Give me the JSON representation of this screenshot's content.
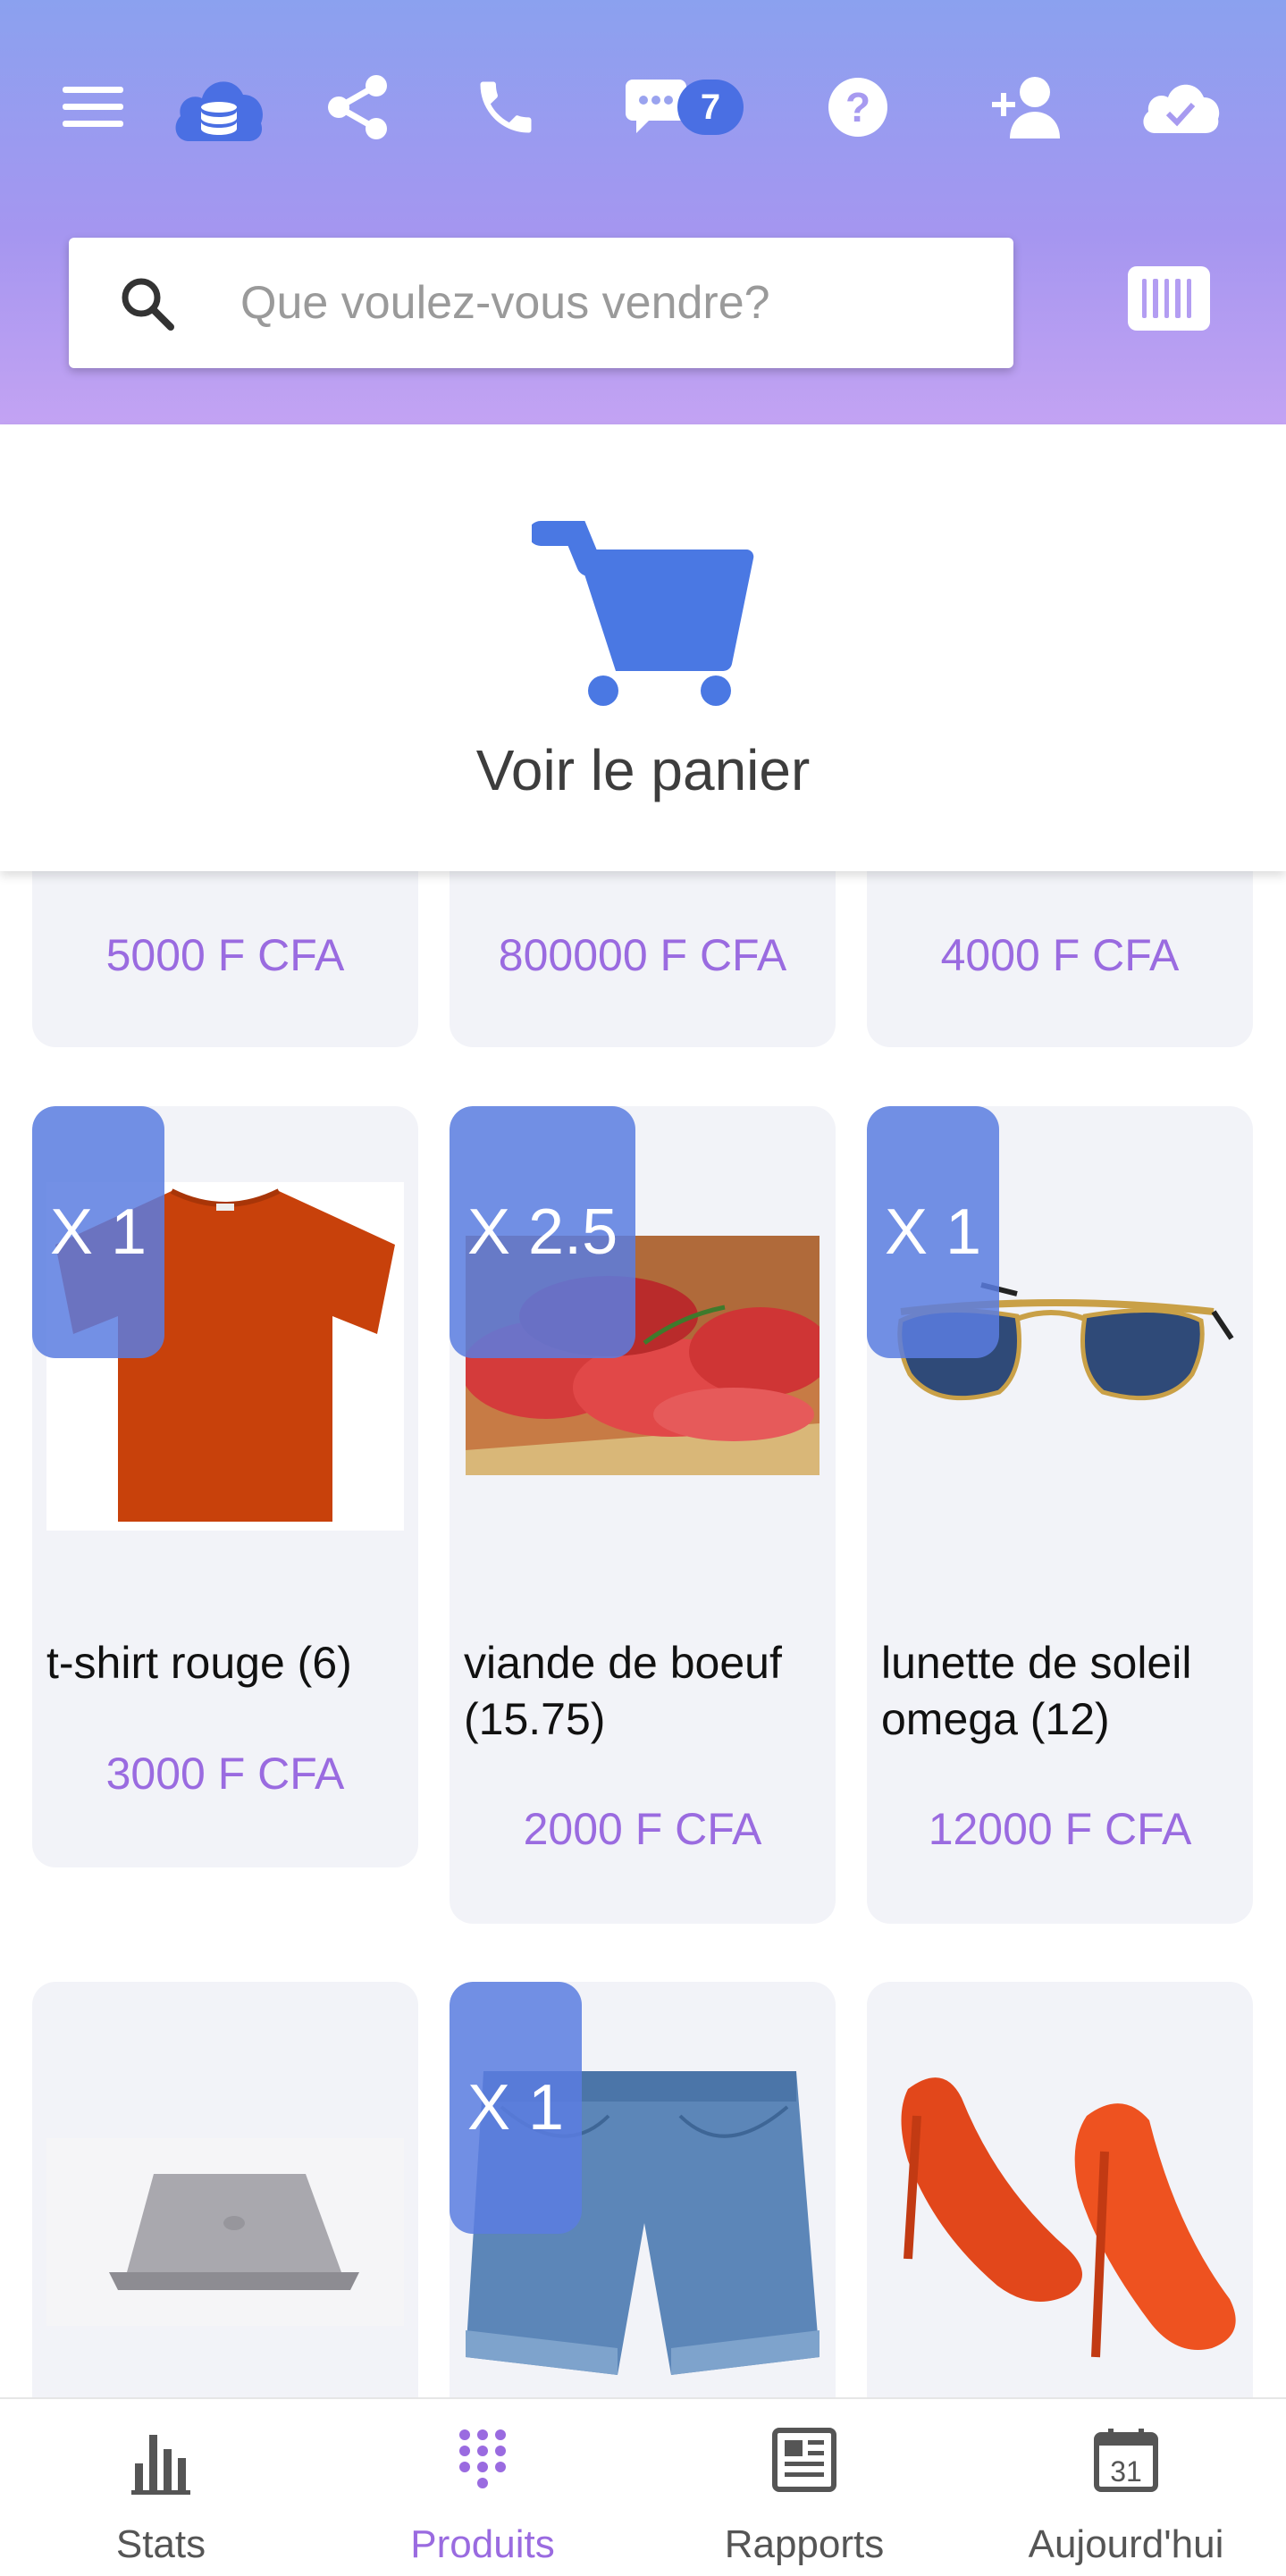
{
  "header": {
    "icons": [
      "menu-icon",
      "cloud-database-icon",
      "share-icon",
      "phone-icon",
      "chat-icon",
      "help-icon",
      "add-user-icon",
      "cloud-check-icon"
    ],
    "chat_badge": "7",
    "search_placeholder": "Que voulez-vous vendre?",
    "barcode_icon": "barcode-icon",
    "colors": {
      "gradient_top": "#8ba1ef",
      "gradient_bottom": "#c3a3f3",
      "badge": "#4a6fe3"
    }
  },
  "cart": {
    "icon": "cart-icon",
    "label": "Voir le panier",
    "color": "#4a78e3"
  },
  "products": {
    "row0": [
      {
        "price": "5000 F CFA"
      },
      {
        "price": "800000 F CFA"
      },
      {
        "price": "4000 F CFA"
      }
    ],
    "row1": [
      {
        "qty": "X 1",
        "name": "t-shirt rouge (6)",
        "price": "3000 F CFA",
        "image": "red-tshirt"
      },
      {
        "qty": "X 2.5",
        "name": "viande de boeuf (15.75)",
        "price": "2000 F CFA",
        "image": "beef-meat"
      },
      {
        "qty": "X 1",
        "name": "lunette de soleil omega (12)",
        "price": "12000 F CFA",
        "image": "sunglasses"
      }
    ],
    "row2": [
      {
        "image": "laptop"
      },
      {
        "qty": "X 1",
        "image": "denim-shorts"
      },
      {
        "image": "orange-heels"
      }
    ],
    "price_color": "#9a6be0"
  },
  "bottom_nav": [
    {
      "label": "Stats",
      "icon": "bar-chart-icon"
    },
    {
      "label": "Produits",
      "icon": "grid-dots-icon",
      "active": true
    },
    {
      "label": "Rapports",
      "icon": "newspaper-icon"
    },
    {
      "label": "Aujourd'hui",
      "icon": "calendar-icon",
      "day": "31"
    }
  ]
}
